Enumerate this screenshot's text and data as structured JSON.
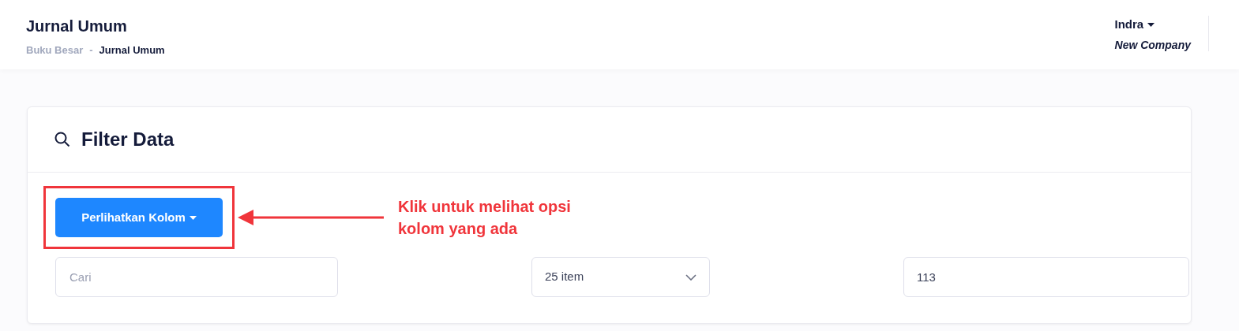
{
  "header": {
    "title": "Jurnal Umum",
    "breadcrumb": [
      {
        "label": "Buku Besar",
        "current": false
      },
      {
        "label": "-",
        "current": false
      },
      {
        "label": "Jurnal Umum",
        "current": true
      }
    ],
    "user": {
      "name": "Indra",
      "company": "New Company"
    }
  },
  "filter_card": {
    "title": "Filter Data",
    "columns_button": "Perlihatkan Kolom",
    "annotation": "Klik untuk melihat opsi\nkolom yang ada",
    "search": {
      "placeholder": "Cari"
    },
    "page_size": {
      "value": "25 item"
    },
    "count_field": {
      "value": "113"
    }
  }
}
